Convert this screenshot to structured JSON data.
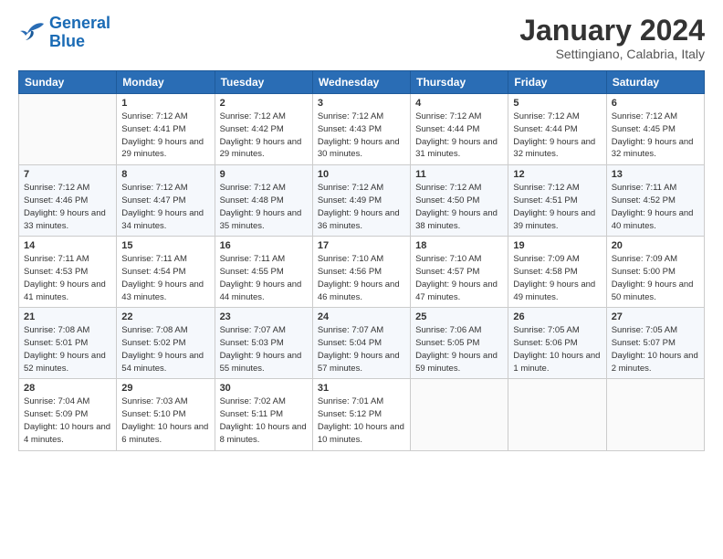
{
  "logo": {
    "line1": "General",
    "line2": "Blue"
  },
  "title": "January 2024",
  "subtitle": "Settingiano, Calabria, Italy",
  "weekdays": [
    "Sunday",
    "Monday",
    "Tuesday",
    "Wednesday",
    "Thursday",
    "Friday",
    "Saturday"
  ],
  "weeks": [
    [
      {
        "day": "",
        "sunrise": "",
        "sunset": "",
        "daylight": ""
      },
      {
        "day": "1",
        "sunrise": "Sunrise: 7:12 AM",
        "sunset": "Sunset: 4:41 PM",
        "daylight": "Daylight: 9 hours and 29 minutes."
      },
      {
        "day": "2",
        "sunrise": "Sunrise: 7:12 AM",
        "sunset": "Sunset: 4:42 PM",
        "daylight": "Daylight: 9 hours and 29 minutes."
      },
      {
        "day": "3",
        "sunrise": "Sunrise: 7:12 AM",
        "sunset": "Sunset: 4:43 PM",
        "daylight": "Daylight: 9 hours and 30 minutes."
      },
      {
        "day": "4",
        "sunrise": "Sunrise: 7:12 AM",
        "sunset": "Sunset: 4:44 PM",
        "daylight": "Daylight: 9 hours and 31 minutes."
      },
      {
        "day": "5",
        "sunrise": "Sunrise: 7:12 AM",
        "sunset": "Sunset: 4:44 PM",
        "daylight": "Daylight: 9 hours and 32 minutes."
      },
      {
        "day": "6",
        "sunrise": "Sunrise: 7:12 AM",
        "sunset": "Sunset: 4:45 PM",
        "daylight": "Daylight: 9 hours and 32 minutes."
      }
    ],
    [
      {
        "day": "7",
        "sunrise": "Sunrise: 7:12 AM",
        "sunset": "Sunset: 4:46 PM",
        "daylight": "Daylight: 9 hours and 33 minutes."
      },
      {
        "day": "8",
        "sunrise": "Sunrise: 7:12 AM",
        "sunset": "Sunset: 4:47 PM",
        "daylight": "Daylight: 9 hours and 34 minutes."
      },
      {
        "day": "9",
        "sunrise": "Sunrise: 7:12 AM",
        "sunset": "Sunset: 4:48 PM",
        "daylight": "Daylight: 9 hours and 35 minutes."
      },
      {
        "day": "10",
        "sunrise": "Sunrise: 7:12 AM",
        "sunset": "Sunset: 4:49 PM",
        "daylight": "Daylight: 9 hours and 36 minutes."
      },
      {
        "day": "11",
        "sunrise": "Sunrise: 7:12 AM",
        "sunset": "Sunset: 4:50 PM",
        "daylight": "Daylight: 9 hours and 38 minutes."
      },
      {
        "day": "12",
        "sunrise": "Sunrise: 7:12 AM",
        "sunset": "Sunset: 4:51 PM",
        "daylight": "Daylight: 9 hours and 39 minutes."
      },
      {
        "day": "13",
        "sunrise": "Sunrise: 7:11 AM",
        "sunset": "Sunset: 4:52 PM",
        "daylight": "Daylight: 9 hours and 40 minutes."
      }
    ],
    [
      {
        "day": "14",
        "sunrise": "Sunrise: 7:11 AM",
        "sunset": "Sunset: 4:53 PM",
        "daylight": "Daylight: 9 hours and 41 minutes."
      },
      {
        "day": "15",
        "sunrise": "Sunrise: 7:11 AM",
        "sunset": "Sunset: 4:54 PM",
        "daylight": "Daylight: 9 hours and 43 minutes."
      },
      {
        "day": "16",
        "sunrise": "Sunrise: 7:11 AM",
        "sunset": "Sunset: 4:55 PM",
        "daylight": "Daylight: 9 hours and 44 minutes."
      },
      {
        "day": "17",
        "sunrise": "Sunrise: 7:10 AM",
        "sunset": "Sunset: 4:56 PM",
        "daylight": "Daylight: 9 hours and 46 minutes."
      },
      {
        "day": "18",
        "sunrise": "Sunrise: 7:10 AM",
        "sunset": "Sunset: 4:57 PM",
        "daylight": "Daylight: 9 hours and 47 minutes."
      },
      {
        "day": "19",
        "sunrise": "Sunrise: 7:09 AM",
        "sunset": "Sunset: 4:58 PM",
        "daylight": "Daylight: 9 hours and 49 minutes."
      },
      {
        "day": "20",
        "sunrise": "Sunrise: 7:09 AM",
        "sunset": "Sunset: 5:00 PM",
        "daylight": "Daylight: 9 hours and 50 minutes."
      }
    ],
    [
      {
        "day": "21",
        "sunrise": "Sunrise: 7:08 AM",
        "sunset": "Sunset: 5:01 PM",
        "daylight": "Daylight: 9 hours and 52 minutes."
      },
      {
        "day": "22",
        "sunrise": "Sunrise: 7:08 AM",
        "sunset": "Sunset: 5:02 PM",
        "daylight": "Daylight: 9 hours and 54 minutes."
      },
      {
        "day": "23",
        "sunrise": "Sunrise: 7:07 AM",
        "sunset": "Sunset: 5:03 PM",
        "daylight": "Daylight: 9 hours and 55 minutes."
      },
      {
        "day": "24",
        "sunrise": "Sunrise: 7:07 AM",
        "sunset": "Sunset: 5:04 PM",
        "daylight": "Daylight: 9 hours and 57 minutes."
      },
      {
        "day": "25",
        "sunrise": "Sunrise: 7:06 AM",
        "sunset": "Sunset: 5:05 PM",
        "daylight": "Daylight: 9 hours and 59 minutes."
      },
      {
        "day": "26",
        "sunrise": "Sunrise: 7:05 AM",
        "sunset": "Sunset: 5:06 PM",
        "daylight": "Daylight: 10 hours and 1 minute."
      },
      {
        "day": "27",
        "sunrise": "Sunrise: 7:05 AM",
        "sunset": "Sunset: 5:07 PM",
        "daylight": "Daylight: 10 hours and 2 minutes."
      }
    ],
    [
      {
        "day": "28",
        "sunrise": "Sunrise: 7:04 AM",
        "sunset": "Sunset: 5:09 PM",
        "daylight": "Daylight: 10 hours and 4 minutes."
      },
      {
        "day": "29",
        "sunrise": "Sunrise: 7:03 AM",
        "sunset": "Sunset: 5:10 PM",
        "daylight": "Daylight: 10 hours and 6 minutes."
      },
      {
        "day": "30",
        "sunrise": "Sunrise: 7:02 AM",
        "sunset": "Sunset: 5:11 PM",
        "daylight": "Daylight: 10 hours and 8 minutes."
      },
      {
        "day": "31",
        "sunrise": "Sunrise: 7:01 AM",
        "sunset": "Sunset: 5:12 PM",
        "daylight": "Daylight: 10 hours and 10 minutes."
      },
      {
        "day": "",
        "sunrise": "",
        "sunset": "",
        "daylight": ""
      },
      {
        "day": "",
        "sunrise": "",
        "sunset": "",
        "daylight": ""
      },
      {
        "day": "",
        "sunrise": "",
        "sunset": "",
        "daylight": ""
      }
    ]
  ]
}
